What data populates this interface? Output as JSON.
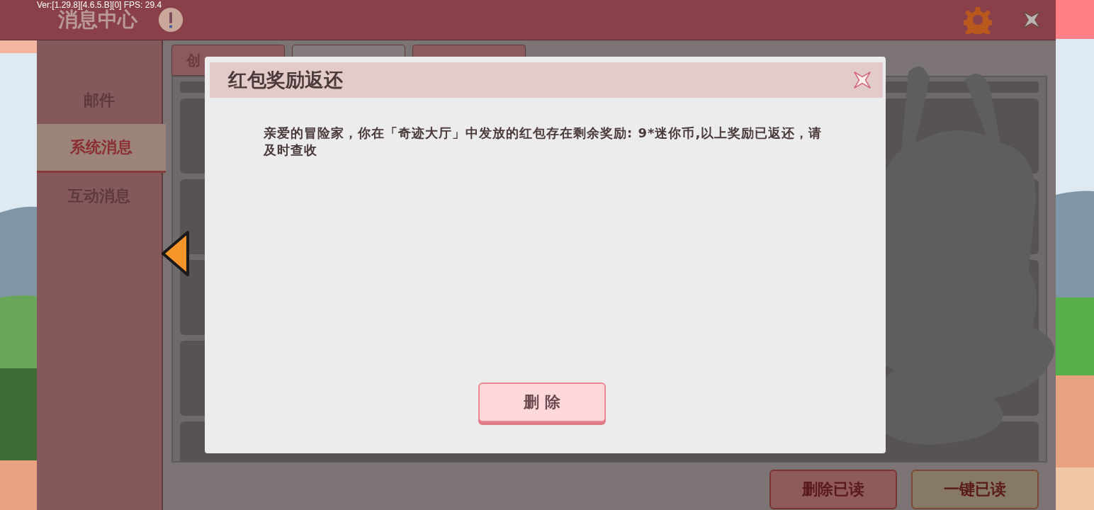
{
  "debug": {
    "text": "Ver:[1.29.8][4.6.5.B][0] FPS: 29.4"
  },
  "header": {
    "title": "消息中心"
  },
  "sidebar": {
    "items": [
      {
        "label": "邮件",
        "selected": false
      },
      {
        "label": "系统消息",
        "selected": true
      },
      {
        "label": "互动消息",
        "selected": false
      }
    ]
  },
  "tabs": [
    {
      "label": "创",
      "selected": false
    },
    {
      "selected": true
    },
    {
      "selected": false
    }
  ],
  "dialog": {
    "title": "红包奖励返还",
    "message": "亲爱的冒险家，你在「奇迹大厅」中发放的红包存在剩余奖励: 9*迷你币,以上奖励已返还，请及时查收",
    "button": "删 除"
  },
  "footer_buttons": [
    {
      "label": "删除已读",
      "kind": "delete"
    },
    {
      "label": "一键已读",
      "kind": "read"
    }
  ]
}
